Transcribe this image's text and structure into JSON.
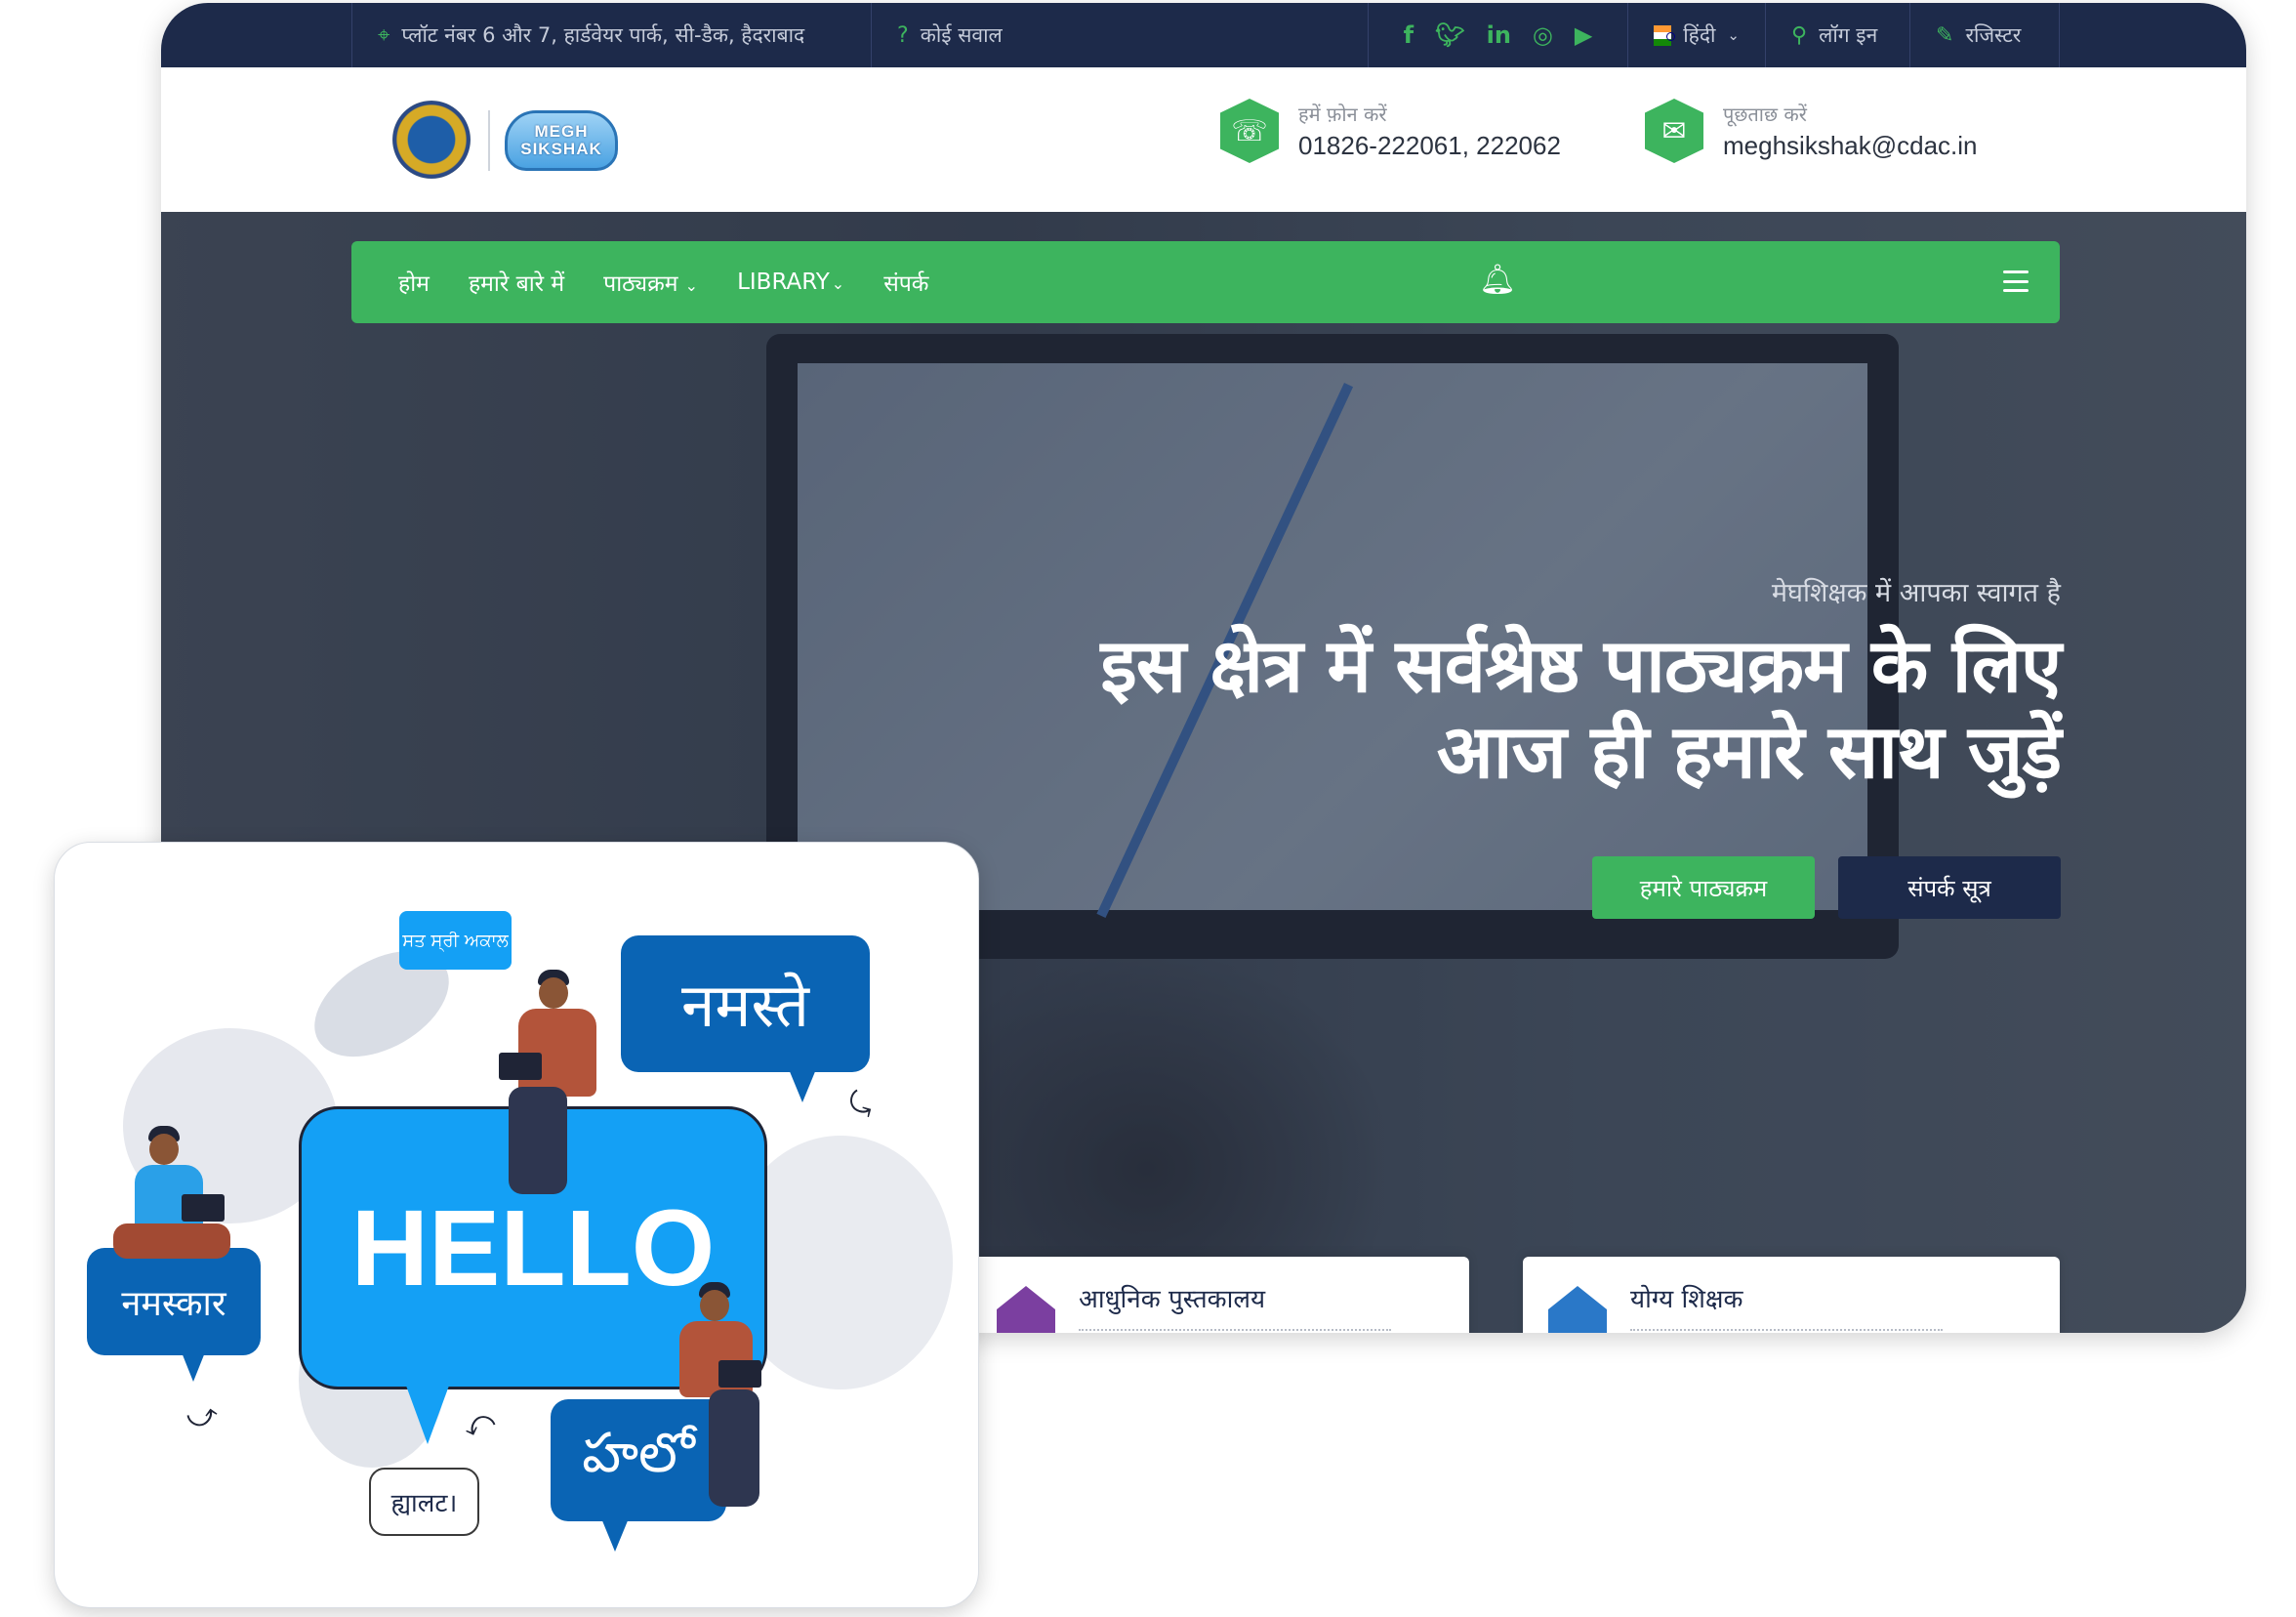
{
  "topbar": {
    "address": "प्लॉट नंबर 6 और 7, हार्डवेयर पार्क, सी-डैक, हैदराबाद",
    "faq": "कोई सवाल",
    "language": "हिंदी",
    "login": "लॉग इन",
    "register": "रजिस्टर",
    "social_icons": [
      "facebook-icon",
      "twitter-icon",
      "linkedin-icon",
      "instagram-icon",
      "youtube-icon"
    ]
  },
  "header": {
    "logo_text_line1": "MEGH",
    "logo_text_line2": "SIKSHAK",
    "phone_label": "हमें फ़ोन करें",
    "phone_value": "01826-222061, 222062",
    "email_label": "पूछताछ करें",
    "email_value": "meghsikshak@cdac.in"
  },
  "nav": {
    "items": [
      {
        "label": "होम",
        "dropdown": false
      },
      {
        "label": "हमारे बारे में",
        "dropdown": false
      },
      {
        "label": "पाठ्यक्रम",
        "dropdown": true
      },
      {
        "label": "LIBRARY",
        "dropdown": true
      },
      {
        "label": "संपर्क",
        "dropdown": false
      }
    ]
  },
  "hero": {
    "welcome": "मेघशिक्षक में आपका स्वागत है",
    "headline_line1": "इस क्षेत्र में सर्वश्रेष्ठ पाठ्यक्रम के लिए",
    "headline_line2": "आज ही हमारे साथ जुड़ें",
    "btn_courses": "हमारे पाठ्यक्रम",
    "btn_contact": "संपर्क सूत्र"
  },
  "features": [
    {
      "title": "आधुनिक पुस्तकालय",
      "icon_color": "#7b3fa0"
    },
    {
      "title": "योग्य शिक्षक",
      "icon_color": "#2a78c8"
    }
  ],
  "illustration": {
    "bubble_punjabi": "ਸਤ ਸ੍ਰੀ ਅਕਾਲ",
    "bubble_namaste": "नमस्ते",
    "bubble_hello": "HELLO",
    "bubble_namaskar": "नमस्कार",
    "bubble_telugu": "హలో",
    "bubble_small": "ह्यालट।"
  },
  "colors": {
    "navy": "#1d2a4a",
    "green": "#3db45e",
    "bubble_blue": "#0a64b4",
    "hello_blue": "#14a0f5"
  }
}
